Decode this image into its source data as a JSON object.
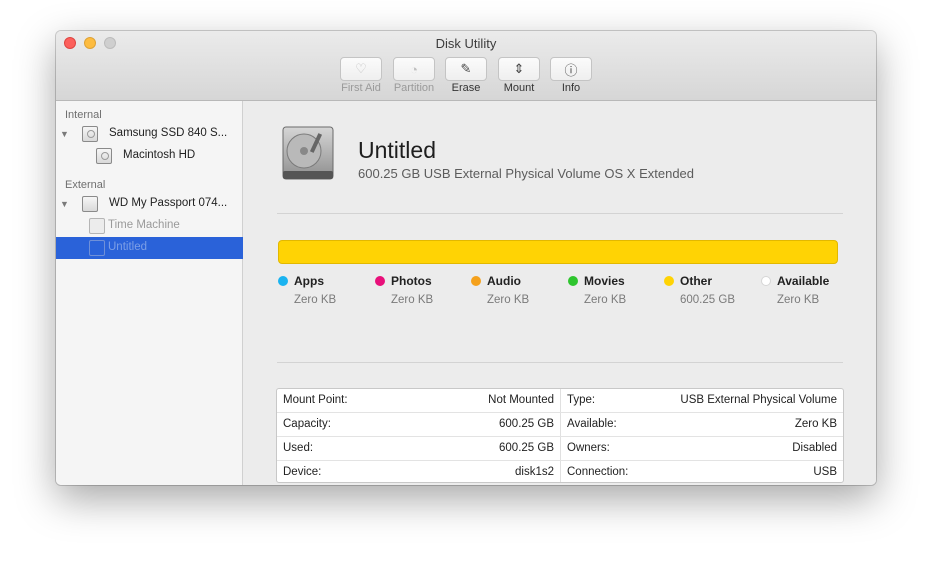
{
  "window": {
    "title": "Disk Utility"
  },
  "toolbar": {
    "buttons": [
      {
        "label": "First Aid",
        "icon": "stethoscope-icon",
        "enabled": false
      },
      {
        "label": "Partition",
        "icon": "pie-icon",
        "enabled": false
      },
      {
        "label": "Erase",
        "icon": "erase-icon",
        "enabled": true
      },
      {
        "label": "Mount",
        "icon": "mount-icon",
        "enabled": true
      },
      {
        "label": "Info",
        "icon": "info-icon",
        "enabled": true
      }
    ]
  },
  "sidebar": {
    "internal_header": "Internal",
    "external_header": "External",
    "internal_disk": "Samsung SSD 840 S...",
    "internal_volume": "Macintosh HD",
    "external_disk": "WD My Passport 074...",
    "external_volume_1": "Time Machine",
    "external_volume_2": "Untitled"
  },
  "volume": {
    "name": "Untitled",
    "description": "600.25 GB USB External Physical Volume OS X Extended"
  },
  "usage": {
    "used_fraction": 1.0,
    "bar_color": "#ffd304",
    "legend": [
      {
        "name": "Apps",
        "value": "Zero KB",
        "color": "#1ab3f0"
      },
      {
        "name": "Photos",
        "value": "Zero KB",
        "color": "#e8107a"
      },
      {
        "name": "Audio",
        "value": "Zero KB",
        "color": "#f5a11c"
      },
      {
        "name": "Movies",
        "value": "Zero KB",
        "color": "#2ec52e"
      },
      {
        "name": "Other",
        "value": "600.25 GB",
        "color": "#ffd304"
      },
      {
        "name": "Available",
        "value": "Zero KB",
        "color": "#ffffff"
      }
    ]
  },
  "info": {
    "rows": [
      {
        "k1": "Mount Point:",
        "v1": "Not Mounted",
        "k2": "Type:",
        "v2": "USB External Physical Volume"
      },
      {
        "k1": "Capacity:",
        "v1": "600.25 GB",
        "k2": "Available:",
        "v2": "Zero KB"
      },
      {
        "k1": "Used:",
        "v1": "600.25 GB",
        "k2": "Owners:",
        "v2": "Disabled"
      },
      {
        "k1": "Device:",
        "v1": "disk1s2",
        "k2": "Connection:",
        "v2": "USB"
      }
    ]
  }
}
